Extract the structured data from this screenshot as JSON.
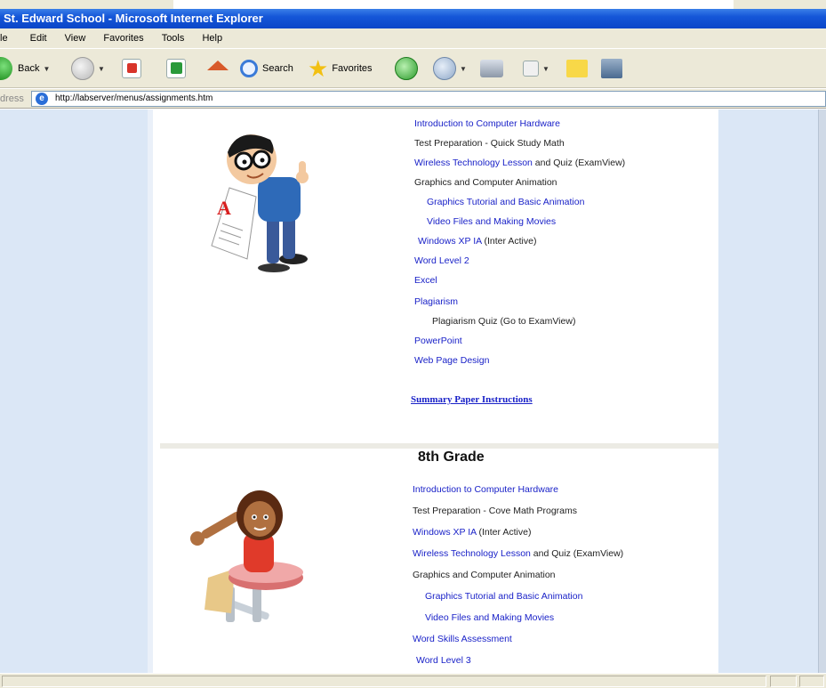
{
  "window": {
    "title": "St. Edward School - Microsoft Internet Explorer"
  },
  "menu": {
    "items": [
      "le",
      "Edit",
      "View",
      "Favorites",
      "Tools",
      "Help"
    ]
  },
  "toolbar": {
    "back_label": "Back",
    "search_label": "Search",
    "favorites_label": "Favorites"
  },
  "address": {
    "label": "dress",
    "url": "http://labserver/menus/assignments.htm"
  },
  "section_7": {
    "links": [
      {
        "text": "Introduction to Computer Hardware"
      },
      {
        "text": "Test Preparation - Quick Study Math"
      },
      {
        "text": "Wireless Technology Lesson",
        "suffix": " and Quiz (ExamView)"
      },
      {
        "text": "Graphics and Computer Animation"
      },
      {
        "text": "Graphics Tutorial and Basic Animation"
      },
      {
        "text": "Video Files and Making Movies"
      },
      {
        "text": "Windows XP IA",
        "suffix": " (Inter Active)"
      },
      {
        "text": "Word  Level 2"
      },
      {
        "text": "Excel"
      },
      {
        "text": "Plagiarism"
      },
      {
        "text": "Plagiarism Quiz (Go to ExamView)"
      },
      {
        "text": "PowerPoint"
      },
      {
        "text": "Web Page Design"
      }
    ],
    "summary": "Summary Paper Instructions"
  },
  "section_8": {
    "heading": "8th Grade",
    "links": [
      {
        "text": "Introduction to Computer Hardware"
      },
      {
        "text": "Test Preparation - Cove Math Programs"
      },
      {
        "text": "Windows XP IA",
        "suffix": " (Inter Active)"
      },
      {
        "text": "Wireless Technology Lesson",
        "suffix": " and Quiz (ExamView)"
      },
      {
        "text": "Graphics and Computer Animation"
      },
      {
        "text": "Graphics Tutorial and Basic Animation"
      },
      {
        "text": "Video Files and Making Movies"
      },
      {
        "text": "Word Skills Assessment"
      },
      {
        "text": "Word Level 3"
      }
    ]
  },
  "colors": {
    "link": "#1a22c8",
    "titlebar": "#0a46c8",
    "sidebar": "#dbe7f6"
  }
}
